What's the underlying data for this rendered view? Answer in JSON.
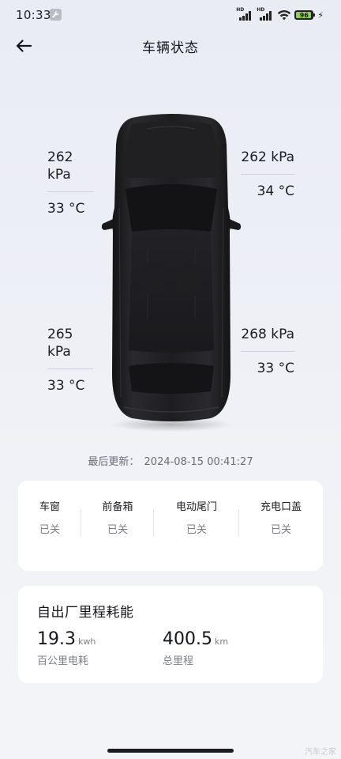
{
  "status_bar": {
    "time": "10:33",
    "icons": [
      "wrench-icon",
      "hd-signal-icon",
      "hd-signal-icon",
      "wifi-icon",
      "battery-icon",
      "charging-bolt-icon"
    ],
    "signal_label": "HD",
    "battery_level": "96",
    "battery_color": "#8fd14f"
  },
  "header": {
    "title": "车辆状态",
    "back_icon": "arrow-left-icon"
  },
  "tires": {
    "front_left": {
      "pressure": "262 kPa",
      "temperature": "33 °C"
    },
    "front_right": {
      "pressure": "262 kPa",
      "temperature": "34 °C"
    },
    "rear_left": {
      "pressure": "265 kPa",
      "temperature": "33 °C"
    },
    "rear_right": {
      "pressure": "268 kPa",
      "temperature": "33 °C"
    }
  },
  "last_update": {
    "label": "最后更新：",
    "value": "2024-08-15 00:41:27"
  },
  "closures": [
    {
      "name": "车窗",
      "state": "已关"
    },
    {
      "name": "前备箱",
      "state": "已关"
    },
    {
      "name": "电动尾门",
      "state": "已关"
    },
    {
      "name": "充电口盖",
      "state": "已关"
    }
  ],
  "energy": {
    "title": "自出厂里程耗能",
    "consumption": {
      "value": "19.3",
      "unit": "kwh",
      "caption": "百公里电耗"
    },
    "mileage": {
      "value": "400.5",
      "unit": "km",
      "caption": "总里程"
    }
  },
  "watermark": "汽车之家",
  "colors": {
    "background": "#eef0f6",
    "card": "#ffffff",
    "car_body": "#1c1c1f",
    "muted_text": "#7b7e86"
  }
}
